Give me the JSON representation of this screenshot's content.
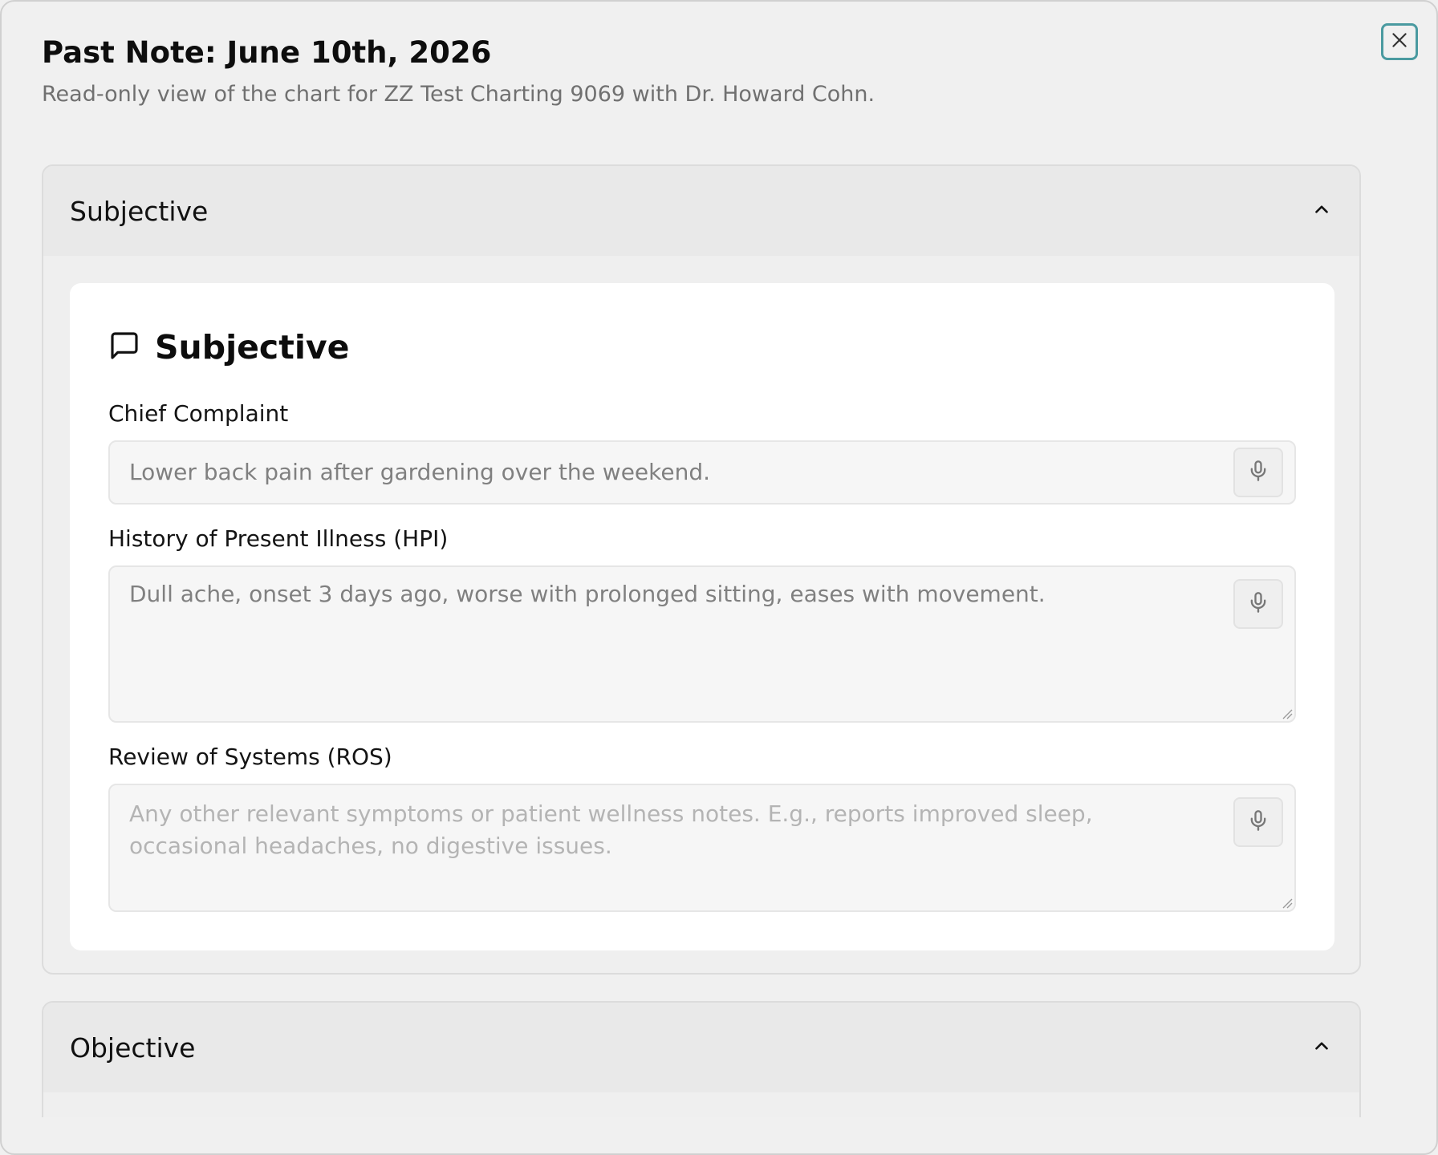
{
  "dialog": {
    "title": "Past Note: June 10th, 2026",
    "subtitle": "Read-only view of the chart for ZZ Test Charting 9069 with Dr. Howard Cohn.",
    "close_icon": "close-icon"
  },
  "sections": {
    "subjective": {
      "header_label": "Subjective",
      "expanded": true,
      "card": {
        "heading": "Subjective",
        "heading_icon": "message-square-icon",
        "fields": {
          "chief_complaint": {
            "label": "Chief Complaint",
            "value": "Lower back pain after gardening over the weekend.",
            "placeholder": ""
          },
          "hpi": {
            "label": "History of Present Illness (HPI)",
            "value": "Dull ache, onset 3 days ago, worse with prolonged sitting, eases with movement.",
            "placeholder": ""
          },
          "ros": {
            "label": "Review of Systems (ROS)",
            "value": "",
            "placeholder": "Any other relevant symptoms or patient wellness notes. E.g., reports improved sleep, occasional headaches, no digestive issues."
          }
        }
      }
    },
    "objective": {
      "header_label": "Objective",
      "expanded": true
    }
  },
  "colors": {
    "background": "#f0f0f0",
    "close_focus_ring": "#4a9aa0",
    "card": "#ffffff",
    "field_bg": "#f6f6f6",
    "value_text": "#808080",
    "placeholder_text": "#b4b4b4"
  }
}
